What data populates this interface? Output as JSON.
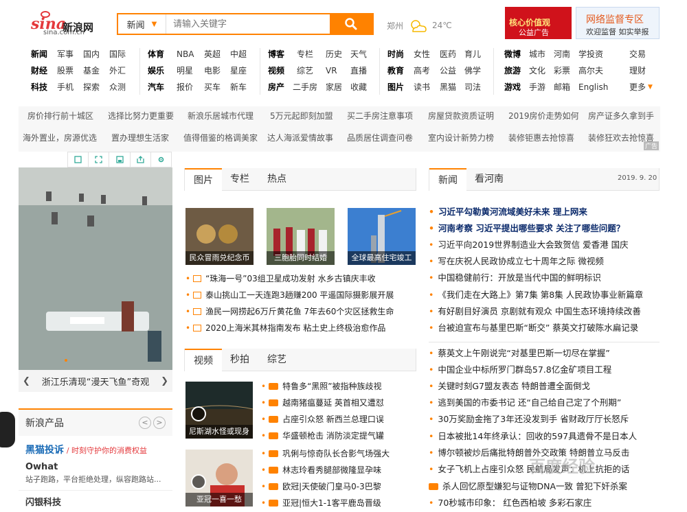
{
  "header": {
    "logo_mark": "sina",
    "logo_cn": "新浪网",
    "logo_domain": "sina.com.cn",
    "search_type": "新闻",
    "search_placeholder": "请输入关键字",
    "weather_city": "郑州",
    "weather_temp": "24℃",
    "ad1_title": "核心价值观",
    "ad1_sub": "公益广告",
    "ad2_title": "网络监督专区",
    "ad2_sub": "欢迎监督 如实举报"
  },
  "nav": {
    "col1": [
      [
        "新闻",
        "军事",
        "国内",
        "国际"
      ],
      [
        "财经",
        "股票",
        "基金",
        "外汇"
      ],
      [
        "科技",
        "手机",
        "探索",
        "众测"
      ]
    ],
    "col2": [
      [
        "体育",
        "NBA",
        "英超",
        "中超"
      ],
      [
        "娱乐",
        "明星",
        "电影",
        "星座"
      ],
      [
        "汽车",
        "报价",
        "买车",
        "新车"
      ]
    ],
    "col3": [
      [
        "博客",
        "专栏",
        "历史",
        "天气"
      ],
      [
        "视频",
        "综艺",
        "VR",
        "直播"
      ],
      [
        "房产",
        "二手房",
        "家居",
        "收藏"
      ]
    ],
    "col4": [
      [
        "时尚",
        "女性",
        "医药",
        "育儿"
      ],
      [
        "教育",
        "高考",
        "公益",
        "佛学"
      ],
      [
        "图片",
        "读书",
        "黑猫",
        "司法"
      ]
    ],
    "col5": [
      [
        "微博",
        "城市",
        "河南",
        "学投资"
      ],
      [
        "旅游",
        "文化",
        "彩票",
        "高尔夫"
      ],
      [
        "游戏",
        "手游",
        "邮箱",
        "English"
      ]
    ],
    "col6": [
      "交易",
      "理财",
      "更多"
    ]
  },
  "linkbar": {
    "row1": [
      "房价排行前十城区",
      "选择比努力更重要",
      "新浪乐居城市代理",
      "5万元起即刻加盟",
      "买二手房注意事项",
      "房屋贷款资质证明",
      "2019房价走势如何",
      "房产证多久拿到手"
    ],
    "row2": [
      "海外置业，房源优选",
      "置办理想生活家",
      "值得借鉴的格调美家",
      "达人海派爱情故事",
      "品质居住调查问卷",
      "室内设计新势力榜",
      "装修钜惠去抢惊喜",
      "装修狂欢去抢惊喜"
    ],
    "ad_tag": "广告"
  },
  "left": {
    "caption": "浙江乐清现“漫天飞鱼”奇观",
    "products_title": "新浪产品",
    "product_name": "黑猫投诉",
    "product_slogan": "/ 时刻守护你的消费权益",
    "owhat_title": "Owhat",
    "owhat_desc": "站子跑路，平台拒绝处理，纵容跑路站...",
    "more_item": "闪银科技"
  },
  "middle": {
    "tabs1": [
      "图片",
      "专栏",
      "热点"
    ],
    "thumbs": [
      "民众冒雨兑纪念币",
      "三胞胎同时结婚",
      "全球最高住宅竣工"
    ],
    "pic_news": [
      "“珠海一号”03组卫星成功发射 水乡古镇庆丰收",
      "泰山挑山工一天连跑3趟赚200 平遥国际摄影展开展",
      "渔民一网捞起6万斤黄花鱼 7年去60个灾区拯救生命",
      "2020上海米其林指南发布 粘土史上终极治愈作品"
    ],
    "tabs2": [
      "视频",
      "秒拍",
      "综艺"
    ],
    "video_thumbs": [
      "尼斯湖水怪或现身",
      "亚冠一喜一愁"
    ],
    "video_news": [
      "特鲁多“黑照”被指种族歧视",
      "越南猪瘟蔓延 英首相又遭怼",
      "占座引众怒 新西兰总理口误",
      "华盛顿枪击 消防淡定提气罐",
      "巩俐与惊奇队长合影气场强大",
      "林志玲看秀腿部微隆显孕味",
      "欧冠|天使破门皇马0-3巴黎",
      "亚冠|恒大1-1客平鹿岛晋级"
    ]
  },
  "right": {
    "tabs": [
      "新闻",
      "看河南"
    ],
    "date": "2019. 9. 20",
    "headlines": [
      "习近平勾勒黄河流域美好未来 理上网来",
      "河南考察 习近平提出哪些要求 关注了哪些问题？"
    ],
    "news1": [
      "习近平向2019世界制造业大会致贺信 爱香港 国庆",
      "写在庆祝人民政协成立七十周年之际 微视频",
      "中国稳健前行：开放是当代中国的鲜明标识",
      "《我们走在大路上》第7集 第8集 人民政协事业新篇章",
      "有好剧目好演员 京剧就有观众 中国生态环境持续改善",
      "台被迫宣布与基里巴斯“断交” 蔡英文打破陈水扁记录"
    ],
    "news2": [
      "蔡英文上午刚说完“对基里巴斯一切尽在掌握”",
      "中国企业中标所罗门群岛57.8亿金矿项目工程",
      "关键时刻G7盟友表态 特朗普遭全面倒戈",
      "逃到美国的市委书记 还“自己给自己定了个刑期”",
      "30万奖励金拖了3年还没发到手 省财政厅厅长怒斥",
      "日本被批14年终承认：回收的597具遗骨不是日本人",
      "博尔顿被炒后痛批特朗普外交政策 特朗普立马反击",
      "女子飞机上占座引众怒 民航局发声：机上抗拒的话",
      "杀人回忆原型嫌犯与证物DNA一致 曾犯下奸杀案",
      "70秒城市印象： 红色西柏坡 多彩石家庄"
    ]
  },
  "watermark": "百度经验",
  "colors": {
    "brand_red": "#e4393c",
    "accent_orange": "#ff8200",
    "headline_blue": "#0b2a6b"
  }
}
